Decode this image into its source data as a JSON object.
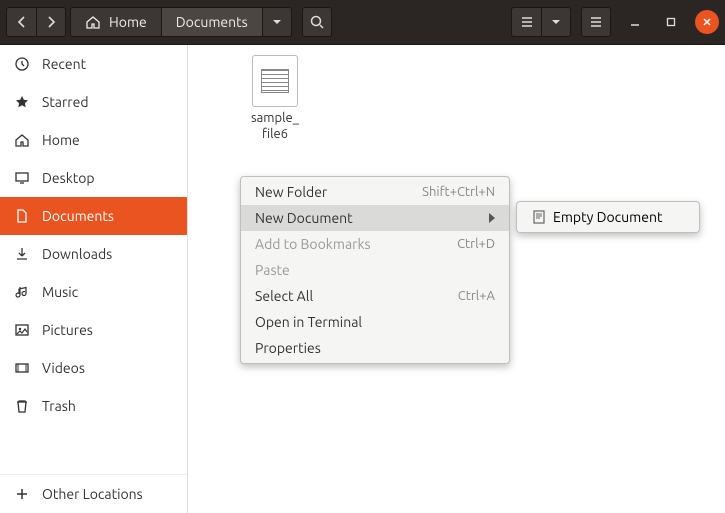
{
  "breadcrumb": {
    "home": "Home",
    "current": "Documents"
  },
  "sidebar": {
    "items": [
      {
        "label": "Recent"
      },
      {
        "label": "Starred"
      },
      {
        "label": "Home"
      },
      {
        "label": "Desktop"
      },
      {
        "label": "Documents"
      },
      {
        "label": "Downloads"
      },
      {
        "label": "Music"
      },
      {
        "label": "Pictures"
      },
      {
        "label": "Videos"
      },
      {
        "label": "Trash"
      }
    ],
    "other_locations": "Other Locations"
  },
  "files": [
    {
      "name": "sample_\nfile6"
    }
  ],
  "context_menu": {
    "items": [
      {
        "label": "New Folder",
        "accel": "Shift+Ctrl+N"
      },
      {
        "label": "New Document",
        "submenu": true,
        "hover": true
      },
      {
        "label": "Add to Bookmarks",
        "accel": "Ctrl+D",
        "disabled": true
      },
      {
        "label": "Paste",
        "disabled": true
      },
      {
        "label": "Select All",
        "accel": "Ctrl+A"
      },
      {
        "label": "Open in Terminal"
      },
      {
        "label": "Properties"
      }
    ]
  },
  "submenu": {
    "items": [
      {
        "label": "Empty Document"
      }
    ]
  }
}
